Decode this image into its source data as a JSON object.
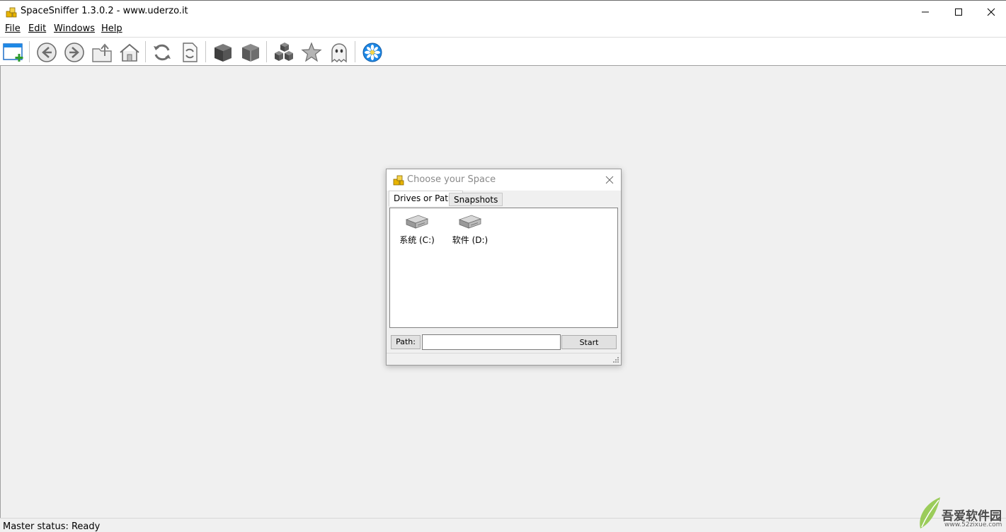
{
  "window": {
    "title": "SpaceSniffer 1.3.0.2 - www.uderzo.it"
  },
  "menu": {
    "items": [
      {
        "label": "File"
      },
      {
        "label": "Edit"
      },
      {
        "label": "Windows"
      },
      {
        "label": "Help"
      }
    ]
  },
  "toolbar": {
    "buttons": [
      {
        "icon": "new-window-icon"
      },
      {
        "icon": "back-arrow-icon"
      },
      {
        "icon": "forward-arrow-icon"
      },
      {
        "icon": "up-folder-icon"
      },
      {
        "icon": "home-icon"
      },
      {
        "icon": "refresh-icon"
      },
      {
        "icon": "refresh-document-icon"
      },
      {
        "icon": "dark-cube-icon"
      },
      {
        "icon": "light-cube-icon"
      },
      {
        "icon": "cubes-icon"
      },
      {
        "icon": "star-icon"
      },
      {
        "icon": "ghost-icon"
      },
      {
        "icon": "flower-icon"
      }
    ]
  },
  "dialog": {
    "title": "Choose your Space",
    "tabs": [
      {
        "label": "Drives or Paths",
        "active": true
      },
      {
        "label": "Snapshots",
        "active": false
      }
    ],
    "drives": [
      {
        "label": "系统 (C:)",
        "icon": "hard-drive-icon"
      },
      {
        "label": "软件 (D:)",
        "icon": "hard-drive-icon"
      }
    ],
    "path_label": "Path:",
    "path_value": "",
    "start_label": "Start"
  },
  "status": {
    "text": "Master status: Ready"
  },
  "watermark": {
    "text": "吾爱软件园",
    "url": "www.52zixue.com"
  },
  "colors": {
    "accent_blue": "#1e88e5",
    "icon_gray": "#7a7a7a",
    "folder_yellow": "#e8b400"
  }
}
